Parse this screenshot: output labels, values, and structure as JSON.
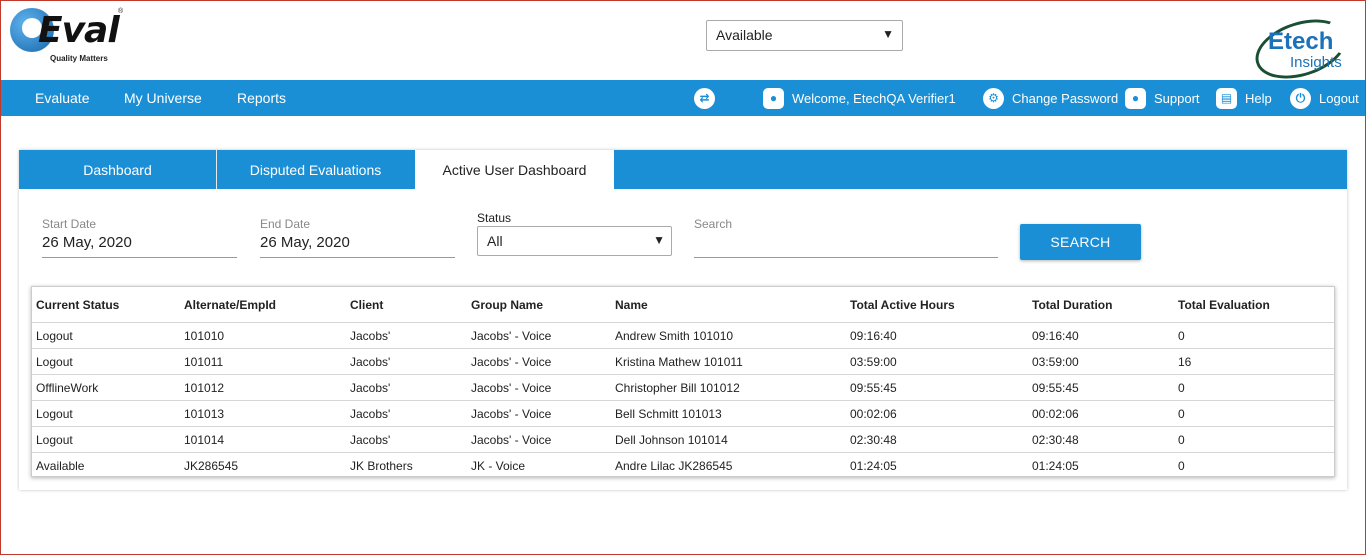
{
  "header": {
    "logo": {
      "name": "QEval",
      "word": "Eval",
      "tagline": "Quality Matters",
      "reg": "®"
    },
    "availability_select": {
      "value": "Available"
    },
    "partner_logo": {
      "line1": "Etech",
      "line2": "Insights"
    }
  },
  "nav": {
    "left": [
      "Evaluate",
      "My Universe",
      "Reports"
    ],
    "welcome": "Welcome, EtechQA Verifier1",
    "change_password": "Change Password",
    "support": "Support",
    "help": "Help",
    "logout": "Logout",
    "icons": [
      "swap-icon",
      "user-icon",
      "gear-icon",
      "user-icon",
      "book-icon",
      "power-icon"
    ]
  },
  "tabs": [
    "Dashboard",
    "Disputed Evaluations",
    "Active User Dashboard"
  ],
  "active_tab": "Active User Dashboard",
  "filters": {
    "start_date": {
      "label": "Start Date",
      "value": "26 May, 2020"
    },
    "end_date": {
      "label": "End Date",
      "value": "26 May, 2020"
    },
    "status": {
      "label": "Status",
      "value": "All"
    },
    "search": {
      "label": "Search",
      "value": ""
    },
    "search_button": "SEARCH"
  },
  "table": {
    "columns": [
      "Current Status",
      "Alternate/EmpId",
      "Client",
      "Group Name",
      "Name",
      "Total Active Hours",
      "Total Duration",
      "Total Evaluation"
    ],
    "rows": [
      [
        "Logout",
        "101010",
        "Jacobs'",
        "Jacobs' - Voice",
        "Andrew Smith 101010",
        "09:16:40",
        "09:16:40",
        "0"
      ],
      [
        "Logout",
        "101011",
        "Jacobs'",
        "Jacobs' - Voice",
        "Kristina Mathew 101011",
        "03:59:00",
        "03:59:00",
        "16"
      ],
      [
        "OfflineWork",
        "101012",
        "Jacobs'",
        "Jacobs' - Voice",
        "Christopher Bill 101012",
        "09:55:45",
        "09:55:45",
        "0"
      ],
      [
        "Logout",
        "101013",
        "Jacobs'",
        "Jacobs' - Voice",
        "Bell Schmitt 101013",
        "00:02:06",
        "00:02:06",
        "0"
      ],
      [
        "Logout",
        "101014",
        "Jacobs'",
        "Jacobs' - Voice",
        "Dell Johnson 101014",
        "02:30:48",
        "02:30:48",
        "0"
      ],
      [
        "Available",
        "JK286545",
        "JK Brothers",
        "JK - Voice",
        "Andre Lilac JK286545",
        "01:24:05",
        "01:24:05",
        "0"
      ]
    ]
  },
  "colors": {
    "primary": "#1a8fd6",
    "frame": "#c0392b"
  }
}
